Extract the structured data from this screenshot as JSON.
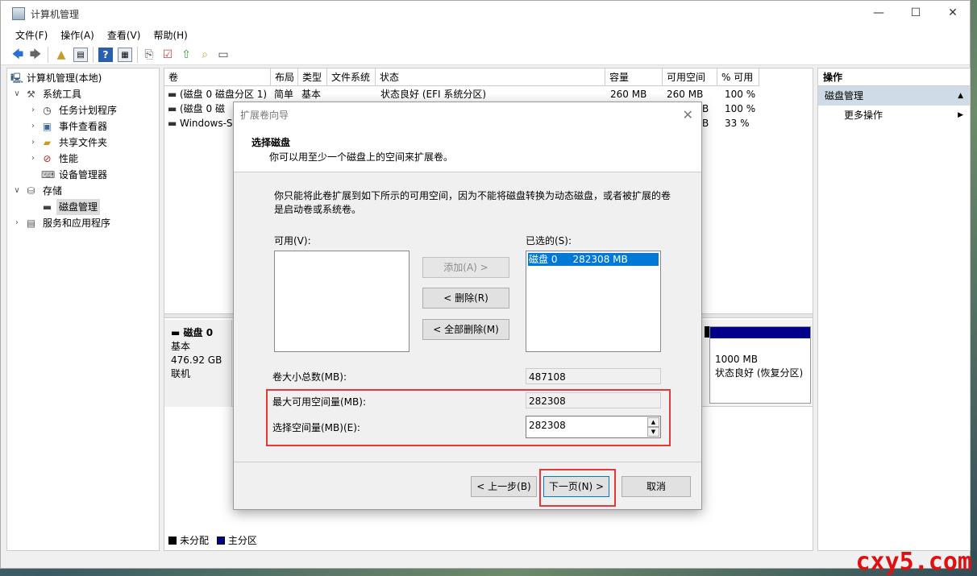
{
  "window": {
    "title": "计算机管理",
    "controls": {
      "minimize": "—",
      "maximize": "☐",
      "close": "✕"
    }
  },
  "menu": [
    "文件(F)",
    "操作(A)",
    "查看(V)",
    "帮助(H)"
  ],
  "tree": {
    "root": "计算机管理(本地)",
    "system_tools": "系统工具",
    "task_scheduler": "任务计划程序",
    "event_viewer": "事件查看器",
    "shared_folders": "共享文件夹",
    "performance": "性能",
    "device_manager": "设备管理器",
    "storage": "存储",
    "disk_management": "磁盘管理",
    "services_apps": "服务和应用程序"
  },
  "volume_table": {
    "headers": [
      "卷",
      "布局",
      "类型",
      "文件系统",
      "状态",
      "容量",
      "可用空间",
      "% 可用"
    ],
    "rows": [
      [
        "(磁盘 0 磁盘分区 1)",
        "简单",
        "基本",
        "",
        "状态良好 (EFI 系统分区)",
        "260 MB",
        "260 MB",
        "100 %"
      ],
      [
        "(磁盘 0 磁",
        "",
        "",
        "",
        "",
        "",
        "B",
        "100 %"
      ],
      [
        "Windows-S:",
        "",
        "",
        "",
        "",
        "",
        "B",
        "33 %"
      ]
    ]
  },
  "disk0": {
    "name": "磁盘 0",
    "type": "基本",
    "size": "476.92 GB",
    "status": "联机",
    "recovery_size": "1000 MB",
    "recovery_status": "状态良好 (恢复分区)"
  },
  "legend": {
    "unallocated": "未分配",
    "primary": "主分区",
    "unallocated_color": "#000000",
    "primary_color": "#00008b"
  },
  "actions": {
    "header": "操作",
    "section": "磁盘管理",
    "more": "更多操作"
  },
  "dialog": {
    "title": "扩展卷向导",
    "heading": "选择磁盘",
    "subheading": "你可以用至少一个磁盘上的空间来扩展卷。",
    "description_line1": "你只能将此卷扩展到如下所示的可用空间，因为不能将磁盘转换为动态磁盘，或者被扩展的卷",
    "description_line2": "是启动卷或系统卷。",
    "available_label": "可用(V):",
    "selected_label": "已选的(S):",
    "selected_item": "磁盘 0     282308 MB",
    "add_button": "添加(A) >",
    "remove_button": "< 删除(R)",
    "remove_all_button": "< 全部删除(M)",
    "total_size_label": "卷大小总数(MB):",
    "total_size_value": "487108",
    "max_space_label": "最大可用空间量(MB):",
    "max_space_value": "282308",
    "select_space_label": "选择空间量(MB)(E):",
    "select_space_value": "282308",
    "back_button": "< 上一步(B)",
    "next_button": "下一页(N) >",
    "cancel_button": "取消",
    "highlight_color": "#e53935",
    "selection_color": "#0078d7"
  },
  "watermark": "cxy5.com"
}
